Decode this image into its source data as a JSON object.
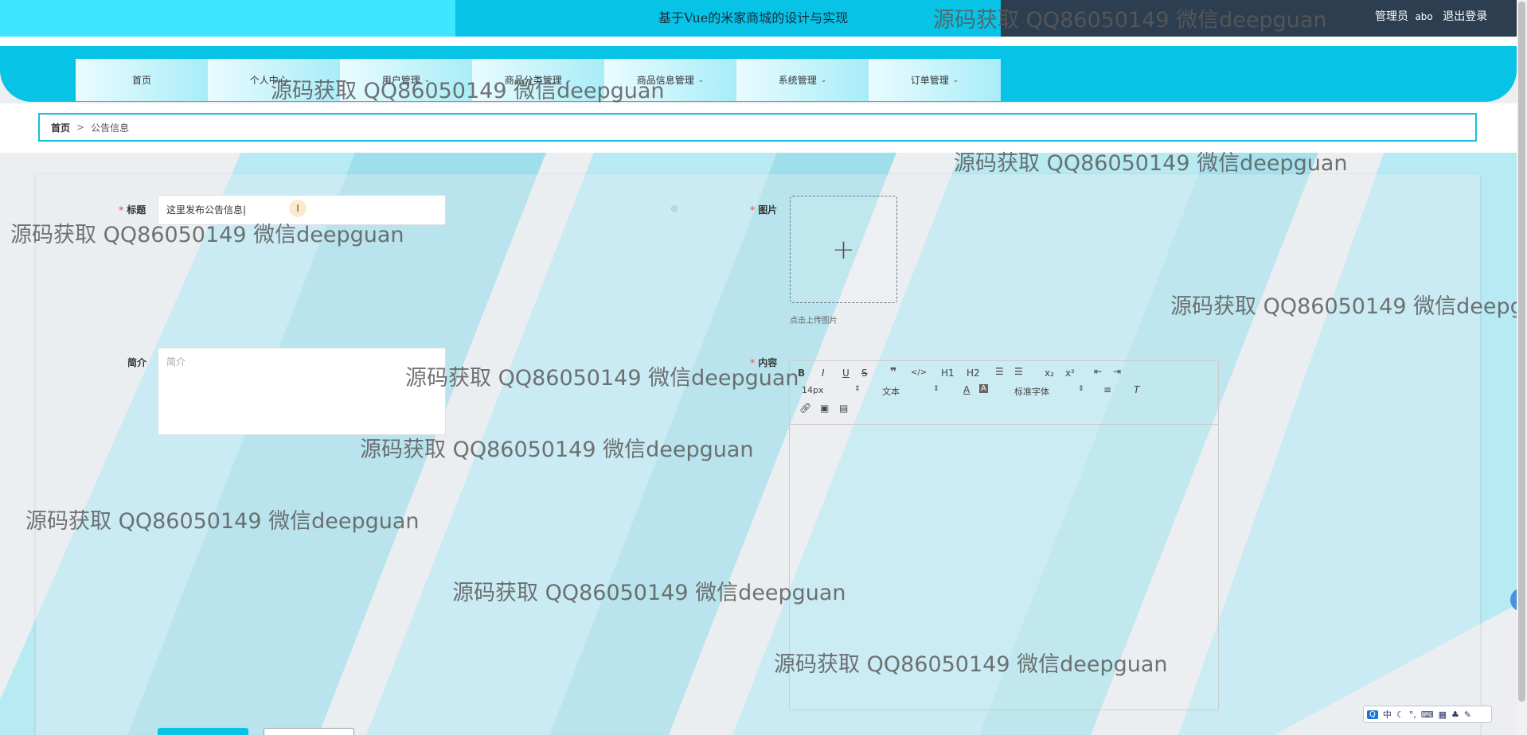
{
  "header": {
    "title": "基于Vue的米家商城的设计与实现",
    "role": "管理员",
    "username": "abo",
    "logout": "退出登录"
  },
  "nav": [
    {
      "label": "首页",
      "dropdown": false
    },
    {
      "label": "个人中心",
      "dropdown": true
    },
    {
      "label": "用户管理",
      "dropdown": true
    },
    {
      "label": "商品分类管理",
      "dropdown": true
    },
    {
      "label": "商品信息管理",
      "dropdown": true
    },
    {
      "label": "系统管理",
      "dropdown": true
    },
    {
      "label": "订单管理",
      "dropdown": true
    }
  ],
  "breadcrumb": {
    "home": "首页",
    "current": "公告信息"
  },
  "form": {
    "title_label": "标题",
    "title_value": "这里发布公告信息",
    "image_label": "图片",
    "upload_tip": "点击上传图片",
    "intro_label": "简介",
    "intro_placeholder": "简介",
    "content_label": "内容"
  },
  "editor_toolbar": {
    "font_size": "14px",
    "header": "文本",
    "font": "标准字体",
    "buttons": [
      "B",
      "I",
      "U",
      "S",
      "❞",
      "</>",
      "H1",
      "H2",
      "ol",
      "ul",
      "x₂",
      "x²",
      "outdent",
      "indent"
    ]
  },
  "watermark": "源码获取 QQ86050149 微信deepguan",
  "ime": {
    "lang": "中"
  },
  "colors": {
    "accent": "#07c3e6",
    "light_accent": "#3ee6ff",
    "dark_bar": "#2c3e50",
    "required": "#f56c6c"
  }
}
